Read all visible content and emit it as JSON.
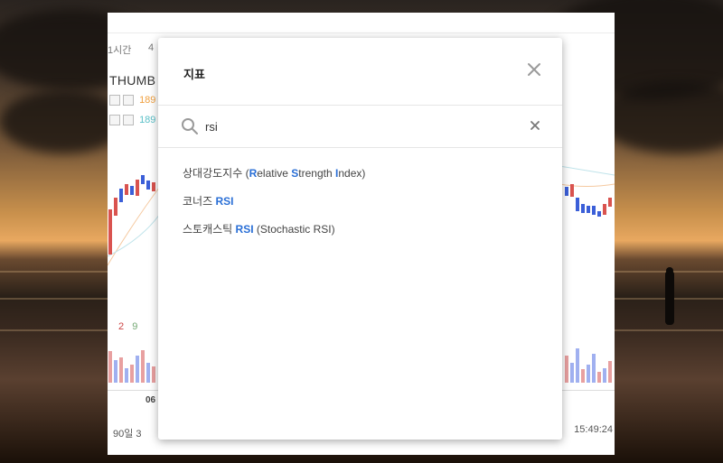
{
  "background_app": {
    "timeframes": [
      "1시간",
      "4"
    ],
    "symbol": "THUMB",
    "indicator_values": [
      {
        "value": "189",
        "color": "#f0a040"
      },
      {
        "value": "189",
        "color": "#5bc0c8"
      }
    ],
    "macd_values": [
      "2",
      "9"
    ],
    "time_label": "06",
    "bottom_left": "90일   3",
    "clock": "15:49:24"
  },
  "modal": {
    "title": "지표",
    "search": {
      "value": "rsi",
      "placeholder": ""
    },
    "results": [
      {
        "parts": [
          {
            "text": "상대강도지수 (",
            "hl": false
          },
          {
            "text": "R",
            "hl": true
          },
          {
            "text": "elative ",
            "hl": false
          },
          {
            "text": "S",
            "hl": true
          },
          {
            "text": "trength ",
            "hl": false
          },
          {
            "text": "I",
            "hl": true
          },
          {
            "text": "ndex)",
            "hl": false
          }
        ]
      },
      {
        "parts": [
          {
            "text": "코너즈 ",
            "hl": false
          },
          {
            "text": "RSI",
            "hl": true
          }
        ]
      },
      {
        "parts": [
          {
            "text": "스토캐스틱 ",
            "hl": false
          },
          {
            "text": "RSI",
            "hl": true
          },
          {
            "text": " (Stochastic RSI)",
            "hl": false
          }
        ]
      }
    ]
  },
  "icons": {
    "close": "close-icon",
    "search": "search-icon",
    "clear": "clear-icon"
  },
  "colors": {
    "accent": "#2a6fd6",
    "up_candle": "#d9534f",
    "down_candle": "#3b5fd8"
  }
}
